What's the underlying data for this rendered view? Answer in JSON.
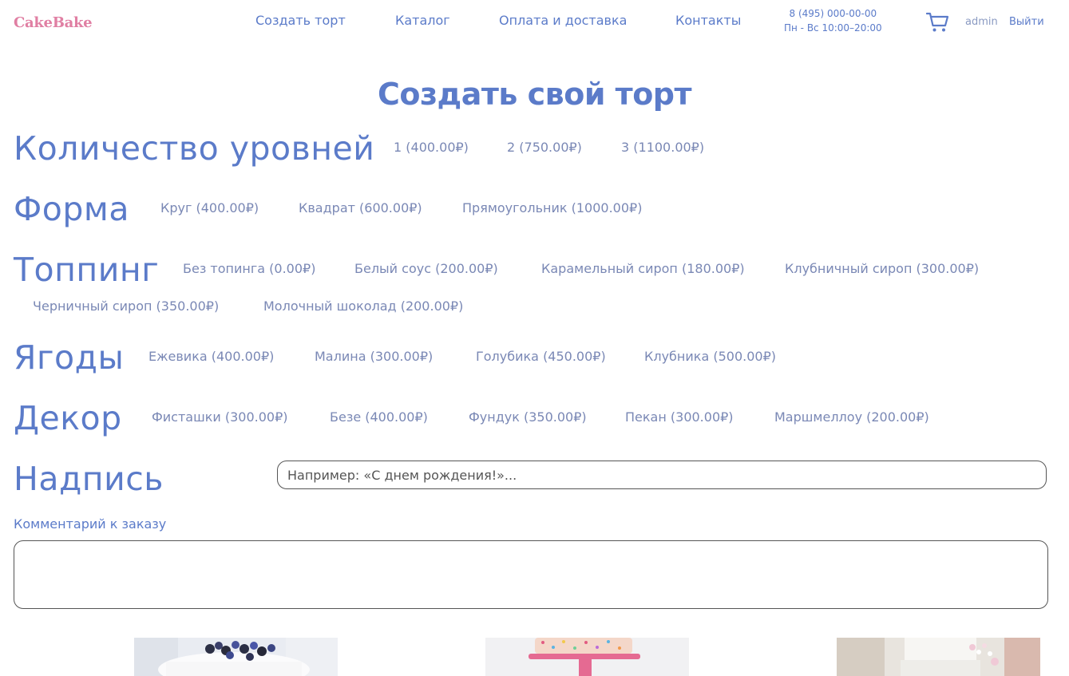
{
  "header": {
    "logo": "CakeBake",
    "nav": [
      "Создать торт",
      "Каталог",
      "Оплата и доставка",
      "Контакты"
    ],
    "phone": "8 (495) 000-00-00",
    "hours": "Пн - Вс 10:00–20:00",
    "user": "admin",
    "logout": "Выйти"
  },
  "page": {
    "title": "Создать свой торт"
  },
  "sections": {
    "levels": {
      "label": "Количество уровней",
      "options": [
        "1 (400.00₽)",
        "2 (750.00₽)",
        "3 (1100.00₽)"
      ]
    },
    "shape": {
      "label": "Форма",
      "options": [
        "Круг (400.00₽)",
        "Квадрат (600.00₽)",
        "Прямоугольник (1000.00₽)"
      ]
    },
    "topping": {
      "label": "Топпинг",
      "options": [
        "Без топинга (0.00₽)",
        "Белый соус (200.00₽)",
        "Карамельный сироп (180.00₽)",
        "Клубничный сироп (300.00₽)",
        "Черничный сироп (350.00₽)",
        "Молочный шоколад (200.00₽)"
      ]
    },
    "berries": {
      "label": "Ягоды",
      "options": [
        "Ежевика (400.00₽)",
        "Малина (300.00₽)",
        "Голубика (450.00₽)",
        "Клубника (500.00₽)"
      ]
    },
    "decor": {
      "label": "Декор",
      "options": [
        "Фисташки (300.00₽)",
        "Безе (400.00₽)",
        "Фундук (350.00₽)",
        "Пекан (300.00₽)",
        "Маршмеллоу (200.00₽)"
      ]
    },
    "inscription": {
      "label": "Надпись",
      "placeholder": "Например: «С днем рождения!»..."
    }
  },
  "comment": {
    "label": "Комментарий к заказу"
  },
  "colors": {
    "brand": "#e07fa3",
    "accent": "#5b7bc9",
    "option": "#7a88b5"
  }
}
